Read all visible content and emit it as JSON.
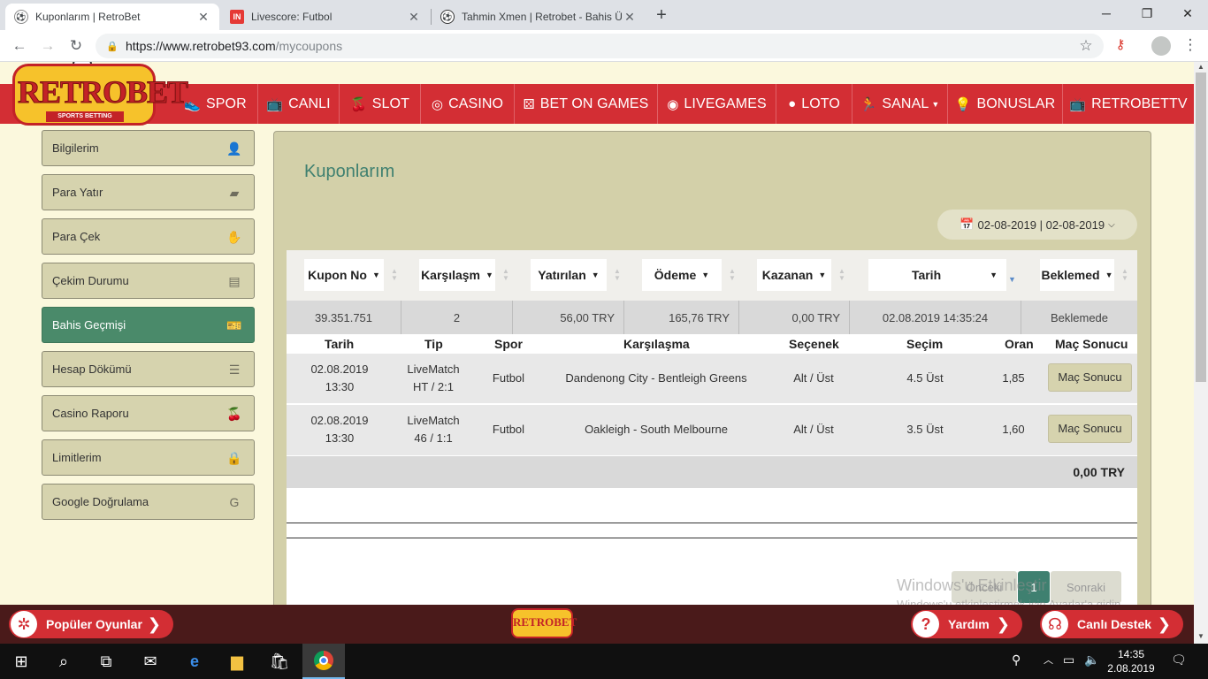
{
  "browser": {
    "tabs": [
      {
        "title": "Kuponlarım | RetroBet",
        "active": true
      },
      {
        "title": "Livescore: Futbol",
        "active": false
      },
      {
        "title": "Tahmin Xmen | Retrobet - Bahis Ü",
        "active": false
      }
    ],
    "url_host": "https://www.retrobet93.com",
    "url_path": "/mycoupons"
  },
  "site": {
    "logo_text": "RETROBET",
    "logo_sub": "SPORTS BETTING",
    "nav": [
      {
        "label": "SPOR",
        "icon": "shoe-icon"
      },
      {
        "label": "CANLI",
        "icon": "tv-icon"
      },
      {
        "label": "SLOT",
        "icon": "cherries-icon"
      },
      {
        "label": "CASINO",
        "icon": "chip-icon"
      },
      {
        "label": "BET ON GAMES",
        "icon": "dice-icon"
      },
      {
        "label": "LIVEGAMES",
        "icon": "target-icon"
      },
      {
        "label": "LOTO",
        "icon": "lotto-ball-icon"
      },
      {
        "label": "SANAL",
        "icon": "runner-icon"
      },
      {
        "label": "BONUSLAR",
        "icon": "bulb-icon"
      },
      {
        "label": "RETROBETTV",
        "icon": "tv-icon"
      }
    ],
    "sidebar": [
      {
        "label": "Bilgilerim",
        "icon": "user-icon"
      },
      {
        "label": "Para Yatır",
        "icon": "wallet-icon"
      },
      {
        "label": "Para Çek",
        "icon": "hand-coins-icon"
      },
      {
        "label": "Çekim Durumu",
        "icon": "money-icon"
      },
      {
        "label": "Bahis Geçmişi",
        "icon": "ticket-icon",
        "active": true
      },
      {
        "label": "Hesap Dökümü",
        "icon": "list-icon"
      },
      {
        "label": "Casino Raporu",
        "icon": "cherry-icon"
      },
      {
        "label": "Limitlerim",
        "icon": "lock-icon"
      },
      {
        "label": "Google Doğrulama",
        "icon": "google-icon"
      }
    ]
  },
  "main": {
    "title": "Kuponlarım",
    "date_range": "02-08-2019 | 02-08-2019",
    "columns": [
      "Kupon No",
      "Karşılaşm",
      "Yatırılan",
      "Ödeme",
      "Kazanan",
      "Tarih",
      "Beklemed"
    ],
    "summary": [
      "39.351.751",
      "2",
      "56,00 TRY",
      "165,76 TRY",
      "0,00 TRY",
      "02.08.2019 14:35:24",
      "Beklemede"
    ],
    "detail_columns": [
      "Tarih",
      "Tip",
      "Spor",
      "Karşılaşma",
      "Seçenek",
      "Seçim",
      "Oran",
      "Maç Sonucu"
    ],
    "rows": [
      {
        "date": "02.08.2019",
        "time": "13:30",
        "tip1": "LiveMatch",
        "tip2": "HT / 2:1",
        "sport": "Futbol",
        "match": "Dandenong City - Bentleigh Greens",
        "option": "Alt / Üst",
        "selection": "4.5 Üst",
        "odds": "1,85",
        "button": "Maç Sonucu"
      },
      {
        "date": "02.08.2019",
        "time": "13:30",
        "tip1": "LiveMatch",
        "tip2": "46 / 1:1",
        "sport": "Futbol",
        "match": "Oakleigh - South Melbourne",
        "option": "Alt / Üst",
        "selection": "3.5 Üst",
        "odds": "1,60",
        "button": "Maç Sonucu"
      }
    ],
    "total": "0,00 TRY",
    "pager": {
      "prev": "Önceki",
      "current": "1",
      "next": "Sonraki"
    }
  },
  "watermark": {
    "line1": "Windows'u Etkinleştir",
    "line2": "Windows'u etkinleştirmek için Ayarlar'a gidin."
  },
  "bottom": {
    "popular": "Popüler Oyunlar",
    "help": "Yardım",
    "support": "Canlı Destek",
    "logo": "RETROBET"
  },
  "taskbar": {
    "time": "14:35",
    "date": "2.08.2019"
  }
}
